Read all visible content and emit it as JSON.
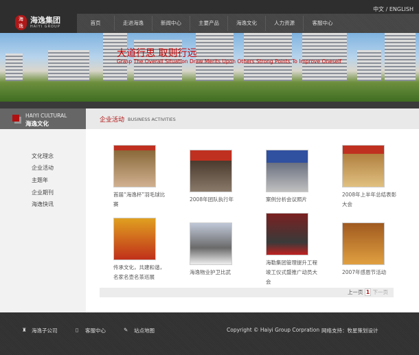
{
  "header": {
    "lang": "中文 / ENGLISH",
    "logo_cn": "海逸集团",
    "logo_en": "HAIYI GROUP",
    "seal": "海逸"
  },
  "nav": [
    "首页",
    "走进海逸",
    "新闻中心",
    "主要产品",
    "海逸文化",
    "人力资源",
    "客服中心"
  ],
  "banner": {
    "slogan": "大道行思  取则行远",
    "slogan_en": "Grasp The Overall Situation Draw Merits Upon Others Strong Points To Improve Oneself"
  },
  "section": {
    "left_en": "HAIYI CULTURAL",
    "left_cn": "海逸文化",
    "title_cn": "企业活动",
    "title_en": "BUSINESS  ACTIVITIES"
  },
  "sidebar": [
    "文化理念",
    "企业活动",
    "主题年",
    "企业期刊",
    "海逸快讯"
  ],
  "items": [
    {
      "caption": "首届“海逸杯”羽毛球比赛",
      "color": "#8a6a3a"
    },
    {
      "caption": "2008年团队执行年",
      "color": "#4a3a2e"
    },
    {
      "caption": "案例分析会议照片",
      "color": "#6a7080"
    },
    {
      "caption": "2008年上半年总结表彰大会",
      "color": "#b08040"
    },
    {
      "caption": "传承文化，共建和谐，名家名壶名茶巡展",
      "color": "#c0301a"
    },
    {
      "caption": "海逸物业护卫比武",
      "color": "#6a6a6a"
    },
    {
      "caption": "海勒集团管理提升工程竣工仪式暨推广动员大会",
      "color": "#7a2020"
    },
    {
      "caption": "2007年感恩节活动",
      "color": "#a05a20"
    }
  ],
  "pager": {
    "prev": "上一页",
    "current": "1",
    "next": "下一页"
  },
  "footer": {
    "subsidiaries": "海逸子公司",
    "service": "客服中心",
    "sitemap": "站点地图",
    "copyright": "Copyright © Haiyi Group Corpration",
    "support": "网络支持：牧星策划设计"
  }
}
